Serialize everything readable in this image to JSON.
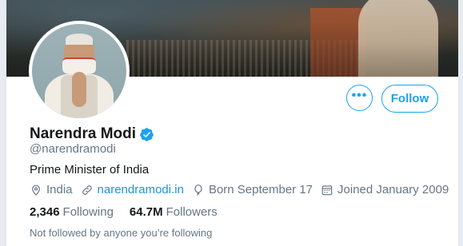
{
  "profile": {
    "name": "Narendra Modi",
    "handle": "@narendramodi",
    "bio": "Prime Minister of India",
    "location": "India",
    "website": "narendramodi.in",
    "born": "Born September 17",
    "joined": "Joined January 2009"
  },
  "stats": {
    "following_count": "2,346",
    "following_label": "Following",
    "followers_count": "64.7M",
    "followers_label": "Followers"
  },
  "actions": {
    "more_label": "•••",
    "follow_label": "Follow"
  },
  "note": "Not followed by anyone you’re following",
  "colors": {
    "accent": "#1da1f2",
    "link": "#1b95e0",
    "secondary_text": "#657786",
    "primary_text": "#14171a"
  },
  "icons": [
    "verified-badge-icon",
    "location-pin-icon",
    "link-icon",
    "balloon-icon",
    "calendar-icon",
    "more-icon"
  ]
}
